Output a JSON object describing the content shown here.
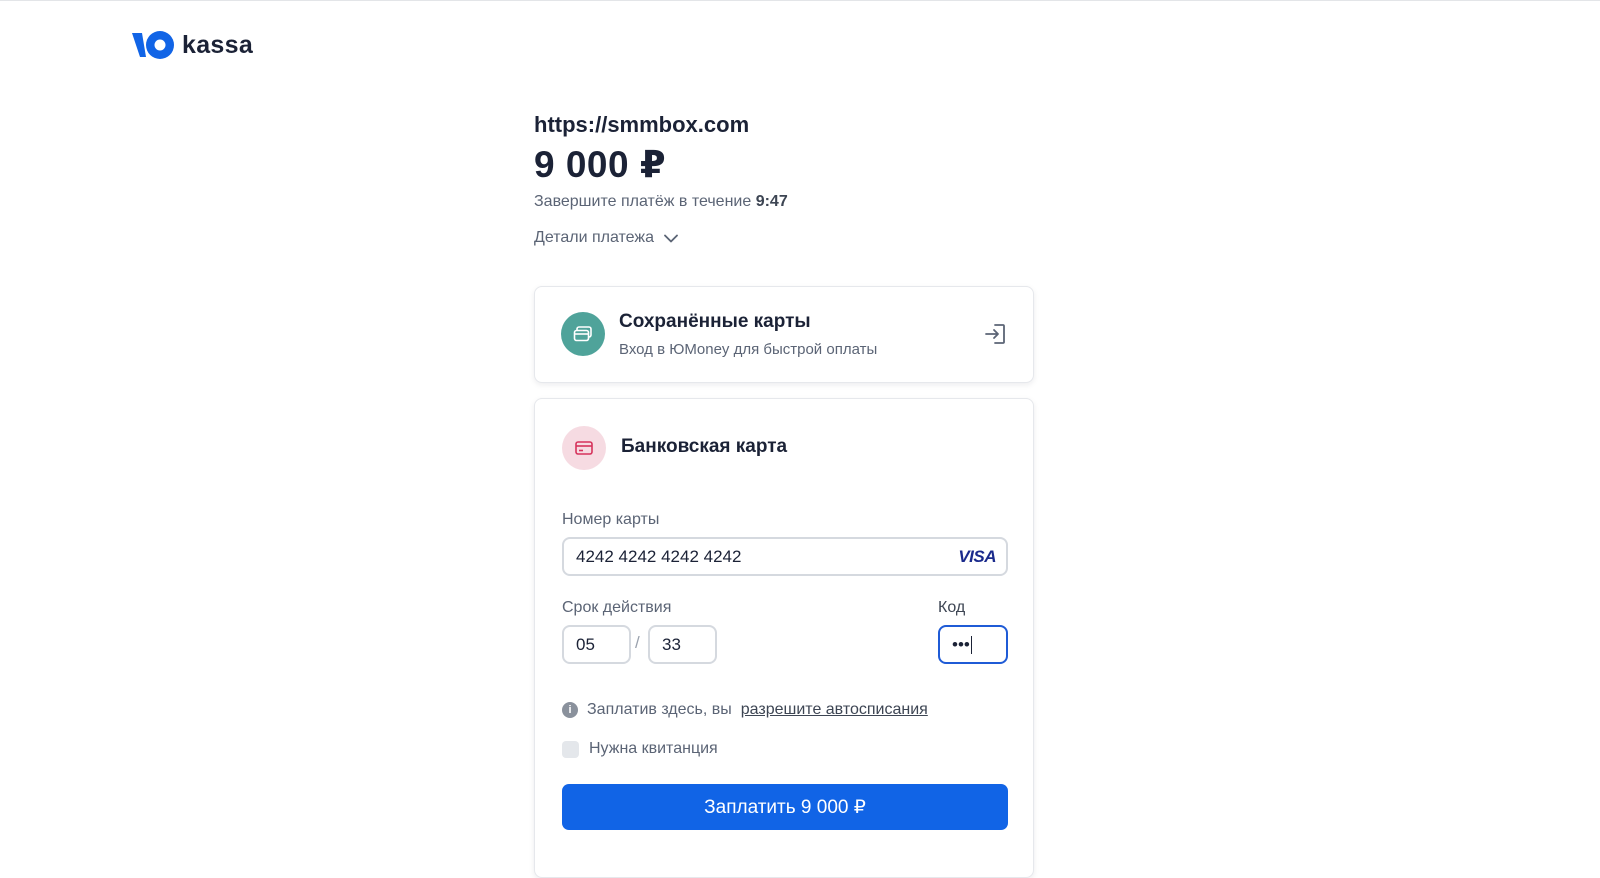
{
  "brand": {
    "logo_text": "kassa"
  },
  "payment": {
    "merchant": "https://smmbox.com",
    "amount": "9 000 ₽",
    "timer_text": "Завершите платёж в течение",
    "timer_value": "9:47",
    "details_label": "Детали платежа"
  },
  "saved_cards": {
    "title": "Сохранённые карты",
    "subtitle": "Вход в ЮMoney для быстрой оплаты"
  },
  "bank_card": {
    "title": "Банковская карта",
    "number_label": "Номер карты",
    "number_value": "4242 4242 4242 4242",
    "brand_mark": "VISA",
    "expiry_label": "Срок действия",
    "expiry_month": "05",
    "expiry_separator": "/",
    "expiry_year": "33",
    "cvc_label": "Код",
    "cvc_value": "•••"
  },
  "autopay": {
    "text": "Заплатив здесь, вы",
    "link": "разрешите автосписания"
  },
  "receipt": {
    "label": "Нужна квитанция"
  },
  "pay_button": {
    "label": "Заплатить 9 000 ₽"
  },
  "colors": {
    "accent": "#1164e6",
    "teal": "#4fa39a",
    "pink": "#f6dbe2",
    "focus": "#1f5bd6"
  },
  "icons": [
    "logo-mark-icon",
    "chevron-down-icon",
    "cards-icon",
    "login-arrow-icon",
    "bank-card-icon",
    "info-icon"
  ]
}
